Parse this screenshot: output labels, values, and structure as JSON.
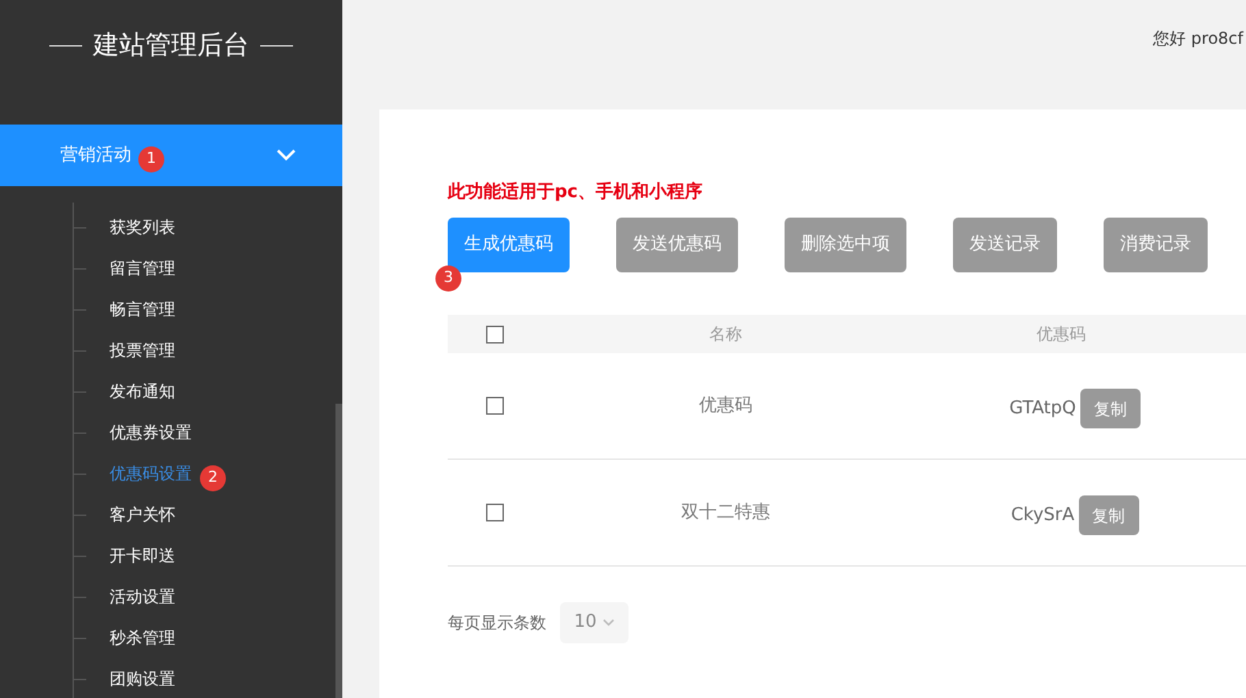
{
  "sidebar": {
    "title": "建站管理后台",
    "menu": {
      "label": "营销活动",
      "expanded": true,
      "badge": "1"
    },
    "items": [
      {
        "label": "获奖列表",
        "selected": false
      },
      {
        "label": "留言管理",
        "selected": false
      },
      {
        "label": "畅言管理",
        "selected": false
      },
      {
        "label": "投票管理",
        "selected": false
      },
      {
        "label": "发布通知",
        "selected": false
      },
      {
        "label": "优惠券设置",
        "selected": false
      },
      {
        "label": "优惠码设置",
        "selected": true,
        "badge": "2"
      },
      {
        "label": "客户关怀",
        "selected": false
      },
      {
        "label": "开卡即送",
        "selected": false
      },
      {
        "label": "活动设置",
        "selected": false
      },
      {
        "label": "秒杀管理",
        "selected": false
      },
      {
        "label": "团购设置",
        "selected": false
      }
    ]
  },
  "header": {
    "greeting": "您好 pro8cf"
  },
  "notice": "此功能适用于pc、手机和小程序",
  "buttons": [
    {
      "label": "生成优惠码",
      "kind": "primary",
      "badge": "3"
    },
    {
      "label": "发送优惠码",
      "kind": "secondary"
    },
    {
      "label": "删除选中项",
      "kind": "secondary"
    },
    {
      "label": "发送记录",
      "kind": "secondary"
    },
    {
      "label": "消费记录",
      "kind": "secondary"
    }
  ],
  "table": {
    "header_checked": false,
    "columns": [
      "名称",
      "优惠码"
    ],
    "rows": [
      {
        "checked": false,
        "name": "优惠码",
        "code": "GTAtpQ",
        "action": "复制"
      },
      {
        "checked": false,
        "name": "双十二特惠",
        "code": "CkySrA",
        "action": "复制"
      }
    ]
  },
  "pagination": {
    "label": "每页显示条数",
    "page_size": "10"
  }
}
